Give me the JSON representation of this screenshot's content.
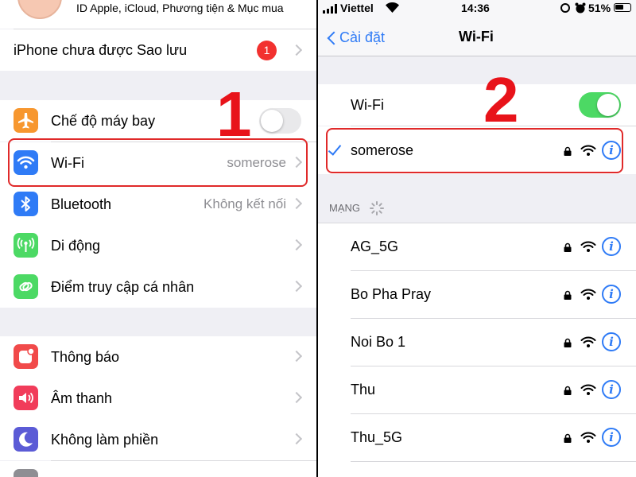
{
  "left": {
    "apple_id_text": "ID Apple, iCloud, Phương tiện & Mục mua",
    "backup_label": "iPhone chưa được Sao lưu",
    "backup_badge": "1",
    "group1": [
      {
        "label": "Chế độ máy bay",
        "icon": "airplane-icon",
        "color": "#f7972f"
      },
      {
        "label": "Wi-Fi",
        "value": "somerose",
        "icon": "wifi-icon",
        "color": "#2f7bf6"
      },
      {
        "label": "Bluetooth",
        "value": "Không kết nối",
        "icon": "bluetooth-icon",
        "color": "#2f7bf6"
      },
      {
        "label": "Di động",
        "icon": "antenna-icon",
        "color": "#4cd964"
      },
      {
        "label": "Điểm truy cập cá nhân",
        "icon": "hotspot-icon",
        "color": "#4cd964"
      }
    ],
    "group2": [
      {
        "label": "Thông báo",
        "icon": "notification-icon",
        "color": "#f14a4a"
      },
      {
        "label": "Âm thanh",
        "icon": "speaker-icon",
        "color": "#f13c5a"
      },
      {
        "label": "Không làm phiền",
        "icon": "moon-icon",
        "color": "#5b5bd6"
      }
    ],
    "annotation_number": "1"
  },
  "right": {
    "status": {
      "carrier": "Viettel",
      "time": "14:36",
      "battery": "51%"
    },
    "nav": {
      "back_label": "Cài đặt",
      "title": "Wi-Fi"
    },
    "wifi_label": "Wi-Fi",
    "connected_network": "somerose",
    "section_header": "MẠNG",
    "networks": [
      "AG_5G",
      "Bo Pha Pray",
      "Noi Bo 1",
      "Thu",
      "Thu_5G"
    ],
    "annotation_number": "2",
    "colors": {
      "accent": "#2f7bf6",
      "toggle_on": "#4cd964",
      "annotation": "#e8131a"
    }
  }
}
